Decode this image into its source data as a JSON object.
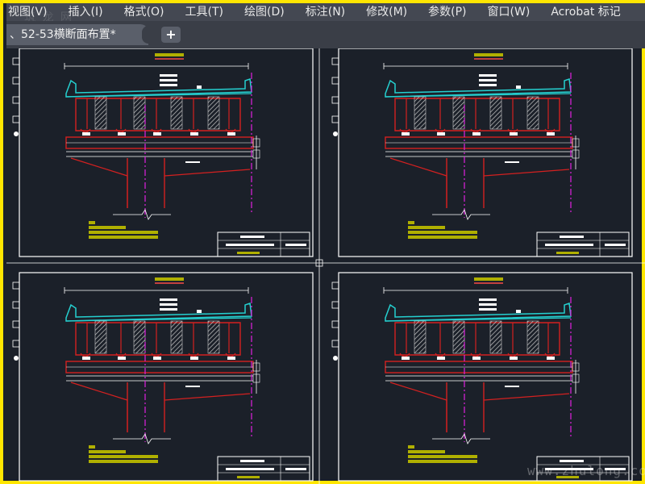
{
  "menubar": {
    "items": [
      "视图(V)",
      "插入(I)",
      "格式(O)",
      "工具(T)",
      "绘图(D)",
      "标注(N)",
      "修改(M)",
      "参数(P)",
      "窗口(W)",
      "Acrobat 标记"
    ]
  },
  "tabs": {
    "active_label": "、52-53横断面布置*",
    "add_label": "+"
  },
  "watermark": {
    "top": "筑 龙 网",
    "bottom": "www.zhulong.com"
  },
  "colors": {
    "background": "#1b2029",
    "frame": "#ffffff",
    "girder": "#d42020",
    "deck": "#25d0d0",
    "centerline": "#e020e0",
    "label": "#b0b000",
    "hatch": "#cccccc"
  },
  "sheets": [
    {
      "id": "top-left"
    },
    {
      "id": "top-right"
    },
    {
      "id": "bottom-left"
    },
    {
      "id": "bottom-right"
    }
  ]
}
